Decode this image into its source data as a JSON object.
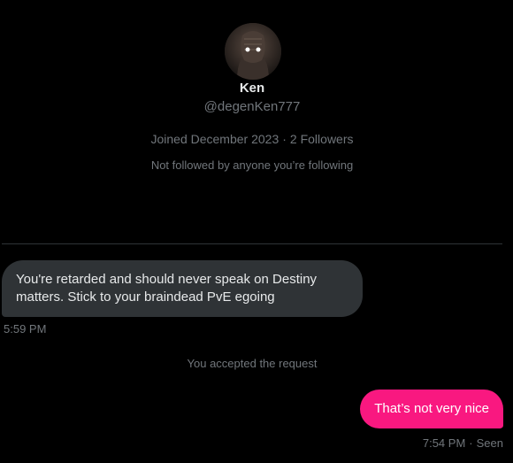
{
  "profile": {
    "name": "Ken",
    "handle": "@degenKen777",
    "joined": "Joined December 2023",
    "followers": "2 Followers",
    "separator": "·",
    "follow_note": "Not followed by anyone you’re following"
  },
  "messages": [
    {
      "direction": "incoming",
      "text": "You're retarded and should never speak on Destiny matters. Stick to your braindead PvE egoing",
      "time": "5:59 PM"
    },
    {
      "direction": "system",
      "text": "You accepted the request"
    },
    {
      "direction": "outgoing",
      "text": "That’s not very nice",
      "time": "7:54 PM",
      "status": "Seen"
    }
  ],
  "colors": {
    "background": "#000000",
    "incoming_bubble": "#2f3336",
    "outgoing_bubble": "#f91880",
    "muted_text": "#71767b"
  }
}
